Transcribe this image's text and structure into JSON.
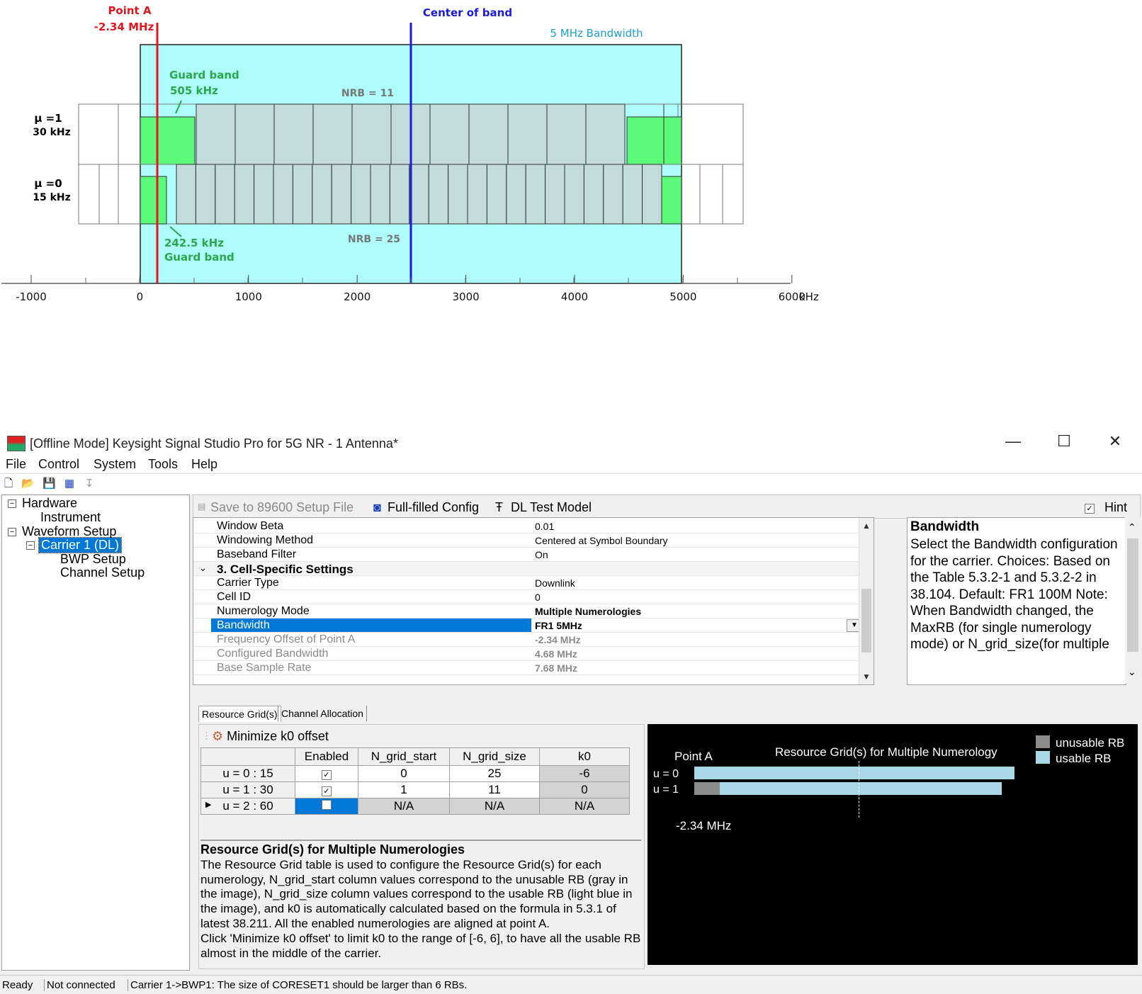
{
  "diagram": {
    "point_a_title": "Point A",
    "point_a_value": "-2.34 MHz",
    "center_label": "Center of band",
    "bandwidth_label": "5 MHz Bandwidth",
    "guard_top_title": "Guard band",
    "guard_top_value": "505 kHz",
    "guard_bottom_value": "242.5 kHz",
    "guard_bottom_title": "Guard band",
    "nrb_top": "NRB = 11",
    "nrb_bottom": "NRB = 25",
    "mu1_label": "μ =1",
    "mu1_scs": "30 kHz",
    "mu0_label": "μ =0",
    "mu0_scs": "15 kHz",
    "axis_ticks": [
      "-1000",
      "0",
      "1000",
      "2000",
      "3000",
      "4000",
      "5000",
      "6000"
    ],
    "axis_unit": "kHz",
    "colors": {
      "band": "#aefcfc",
      "guard": "#5cf97a",
      "rb": "#c3dbdb",
      "point_a": "#e5161c",
      "center": "#1a1ae0",
      "guard_text": "#2aa84a",
      "bw_text": "#1aa0d8"
    }
  },
  "window": {
    "title": "[Offline Mode] Keysight Signal Studio Pro for 5G NR - 1 Antenna*",
    "controls": {
      "minimize": "—",
      "maximize": "☐",
      "close": "✕"
    }
  },
  "menu": [
    "File",
    "Control",
    "System",
    "Tools",
    "Help"
  ],
  "tree": {
    "hardware": "Hardware",
    "instrument": "Instrument",
    "waveform_setup": "Waveform Setup",
    "carrier": "Carrier 1 (DL)",
    "bwp_setup": "BWP Setup",
    "channel_setup": "Channel Setup"
  },
  "commands": {
    "save": "Save to 89600 Setup File",
    "fullfilled": "Full-filled Config",
    "dl_test_model": "DL Test Model",
    "hint": "Hint"
  },
  "properties": [
    {
      "name": "Window Beta",
      "value": "0.01"
    },
    {
      "name": "Windowing Method",
      "value": "Centered at Symbol Boundary"
    },
    {
      "name": "Baseband Filter",
      "value": "On"
    },
    {
      "name": "3. Cell-Specific Settings",
      "value": ""
    },
    {
      "name": "Carrier Type",
      "value": "Downlink"
    },
    {
      "name": "Cell ID",
      "value": "0"
    },
    {
      "name": "Numerology Mode",
      "value": "Multiple Numerologies"
    },
    {
      "name": "Bandwidth",
      "value": "FR1 5MHz"
    },
    {
      "name": "Frequency Offset of Point A",
      "value": "-2.34 MHz"
    },
    {
      "name": "Configured Bandwidth",
      "value": "4.68 MHz"
    },
    {
      "name": "Base Sample Rate",
      "value": "7.68 MHz"
    }
  ],
  "hint_panel": {
    "title": "Bandwidth",
    "body": "Select the Bandwidth configuration for the carrier. Choices: Based on the Table 5.3.2-1 and 5.3.2-2 in 38.104. Default: FR1 100M Note: When Bandwidth changed, the MaxRB (for single numerology mode) or N_grid_size(for multiple"
  },
  "tabs": [
    "Resource Grid(s)",
    "Channel Allocation"
  ],
  "resource_grid": {
    "minimize_label": "Minimize k0 offset",
    "headers": [
      "Enabled",
      "N_grid_start",
      "N_grid_size",
      "k0"
    ],
    "rows": [
      {
        "label": "u = 0 : 15",
        "enabled": "✓",
        "start": "0",
        "size": "25",
        "k0": "-6"
      },
      {
        "label": "u = 1 : 30",
        "enabled": "✓",
        "start": "1",
        "size": "11",
        "k0": "0"
      },
      {
        "label": "u = 2 : 60",
        "enabled": "",
        "start": "N/A",
        "size": "N/A",
        "k0": "N/A"
      }
    ],
    "desc_title": "Resource Grid(s) for Multiple Numerologies",
    "desc_body": "The Resource Grid table is used to configure the Resource Grid(s) for each numerology, N_grid_start column values correspond to the unusable RB (gray in the image), N_grid_size column values correspond to the usable RB (light blue in the image), and k0 is automatically calculated based on the formula in 5.3.1 of latest 38.211. All the enabled numerologies are aligned at point A.",
    "desc_note": " Click 'Minimize k0 offset' to limit k0 to the range of [-6, 6], to have all the usable RB almost in the middle of the carrier."
  },
  "grid_chart": {
    "title": "Resource Grid(s) for Multiple Numerology",
    "point_a_label": "Point A",
    "row_labels": [
      "u = 0",
      "u = 1"
    ],
    "freq_label": "-2.34 MHz",
    "legend_unusable": "unusable RB",
    "legend_usable": "usable RB",
    "colors": {
      "unusable": "#8c8c8c",
      "usable": "#a8d8e6"
    }
  },
  "status": {
    "ready": "Ready",
    "connection": "Not connected",
    "message": "Carrier 1->BWP1: The size of CORESET1 should be larger than 6 RBs."
  }
}
